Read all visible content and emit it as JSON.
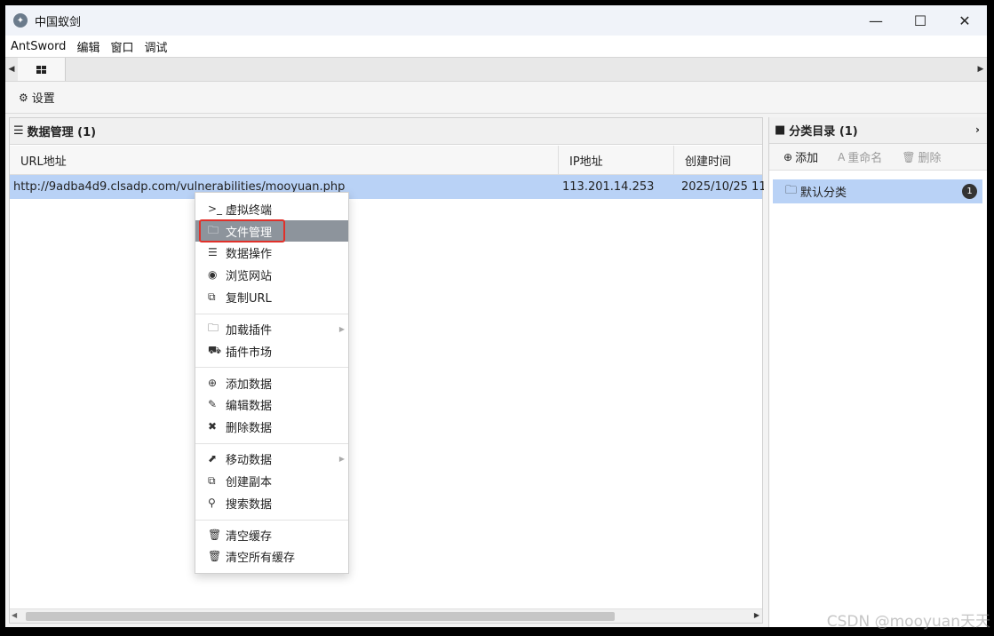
{
  "window": {
    "title": "中国蚁剑",
    "minimize": "—",
    "maximize": "☐",
    "close": "✕"
  },
  "menubar": [
    "AntSword",
    "编辑",
    "窗口",
    "调试"
  ],
  "toolbar": {
    "settings_label": "设置"
  },
  "main_panel": {
    "title": "数据管理 (1)",
    "columns": [
      "URL地址",
      "IP地址",
      "创建时间"
    ],
    "rows": [
      {
        "url": "http://9adba4d9.clsadp.com/vulnerabilities/mooyuan.php",
        "ip": "113.201.14.253",
        "created": "2025/10/25 11:"
      }
    ]
  },
  "side_panel": {
    "title": "分类目录 (1)",
    "tools": {
      "add": "添加",
      "rename": "重命名",
      "delete": "删除"
    },
    "categories": [
      {
        "name": "默认分类",
        "count": "1"
      }
    ]
  },
  "context_menu": {
    "groups": [
      [
        {
          "label": "虚拟终端",
          "icon": "terminal-icon"
        },
        {
          "label": "文件管理",
          "icon": "folder-icon",
          "active": true
        },
        {
          "label": "数据操作",
          "icon": "database-icon"
        },
        {
          "label": "浏览网站",
          "icon": "chrome-icon"
        },
        {
          "label": "复制URL",
          "icon": "copy-icon"
        }
      ],
      [
        {
          "label": "加载插件",
          "icon": "folder-icon",
          "submenu": true
        },
        {
          "label": "插件市场",
          "icon": "cart-icon"
        }
      ],
      [
        {
          "label": "添加数据",
          "icon": "plus-circle-icon"
        },
        {
          "label": "编辑数据",
          "icon": "edit-icon"
        },
        {
          "label": "删除数据",
          "icon": "times-icon"
        }
      ],
      [
        {
          "label": "移动数据",
          "icon": "share-icon",
          "submenu": true
        },
        {
          "label": "创建副本",
          "icon": "copy-icon"
        },
        {
          "label": "搜索数据",
          "icon": "search-icon"
        }
      ],
      [
        {
          "label": "清空缓存",
          "icon": "trash-outline-icon"
        },
        {
          "label": "清空所有缓存",
          "icon": "trash-icon"
        }
      ]
    ]
  },
  "watermark": "CSDN @mooyuan天天",
  "colors": {
    "selection": "#b9d2f6",
    "menu_active": "#8d949c",
    "highlight_box": "#e0312a"
  }
}
